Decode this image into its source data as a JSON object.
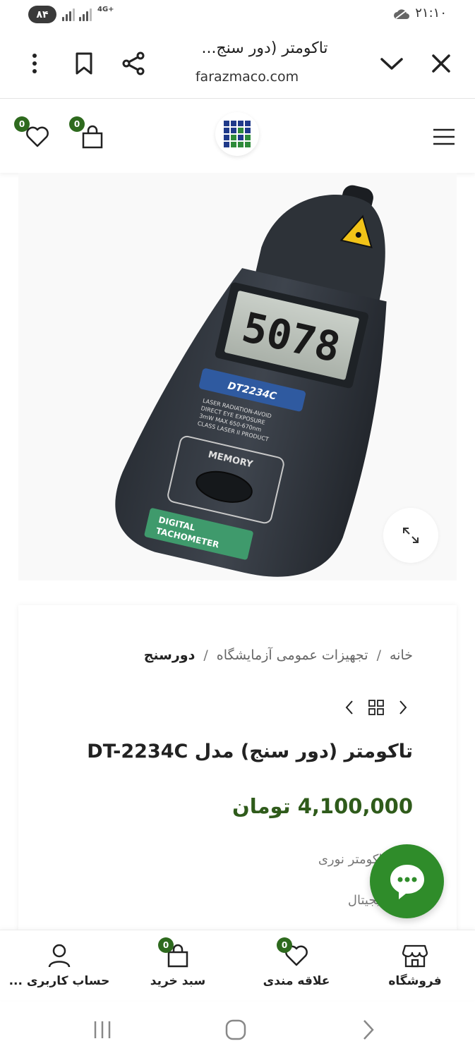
{
  "status_bar": {
    "battery": "۸۴",
    "network": "4G+",
    "time": "۲۱:۱۰"
  },
  "browser": {
    "title": "تاکومتر (دور سنج...",
    "url": "farazmaco.com",
    "icons": [
      "close-icon",
      "chevron-down-icon",
      "share-icon",
      "bookmark-icon",
      "more-vertical-icon"
    ]
  },
  "header": {
    "wishlist_count": "0",
    "cart_count": "0",
    "logo_colors": [
      "#1f3a8a",
      "#2e8b3a"
    ]
  },
  "product": {
    "breadcrumb": {
      "home": "خانه",
      "category": "تجهیزات عمومی آزمایشگاه",
      "current": "دورسنج",
      "separator": "/"
    },
    "title": "تاکومتر (دور سنج) مدل DT-2234C",
    "price": "4,100,000 تومان",
    "meta_1": "تاکومتر نوری",
    "meta_2": "دیجیتال",
    "device": {
      "display": "5078",
      "brand_label": "DT2234C",
      "memory_label": "MEMORY",
      "bottom_label_1": "DIGITAL",
      "bottom_label_2": "TACHOMETER",
      "warning_1": "LASER RADIATION-AVOID",
      "warning_2": "DIRECT EYE EXPOSURE",
      "warning_3": "3mW MAX 650-670nm",
      "warning_4": "CLASS LASER II PRODUCT"
    }
  },
  "bottom_nav": {
    "shop": "فروشگاه",
    "wishlist": "علاقه مندی",
    "wishlist_count": "0",
    "cart": "سبد خرید",
    "cart_count": "0",
    "account": "حساب کاربری ..."
  },
  "colors": {
    "accent_green": "#2e6a1e",
    "price_green": "#2f5b1b",
    "fab_green": "#2f8c2a"
  }
}
